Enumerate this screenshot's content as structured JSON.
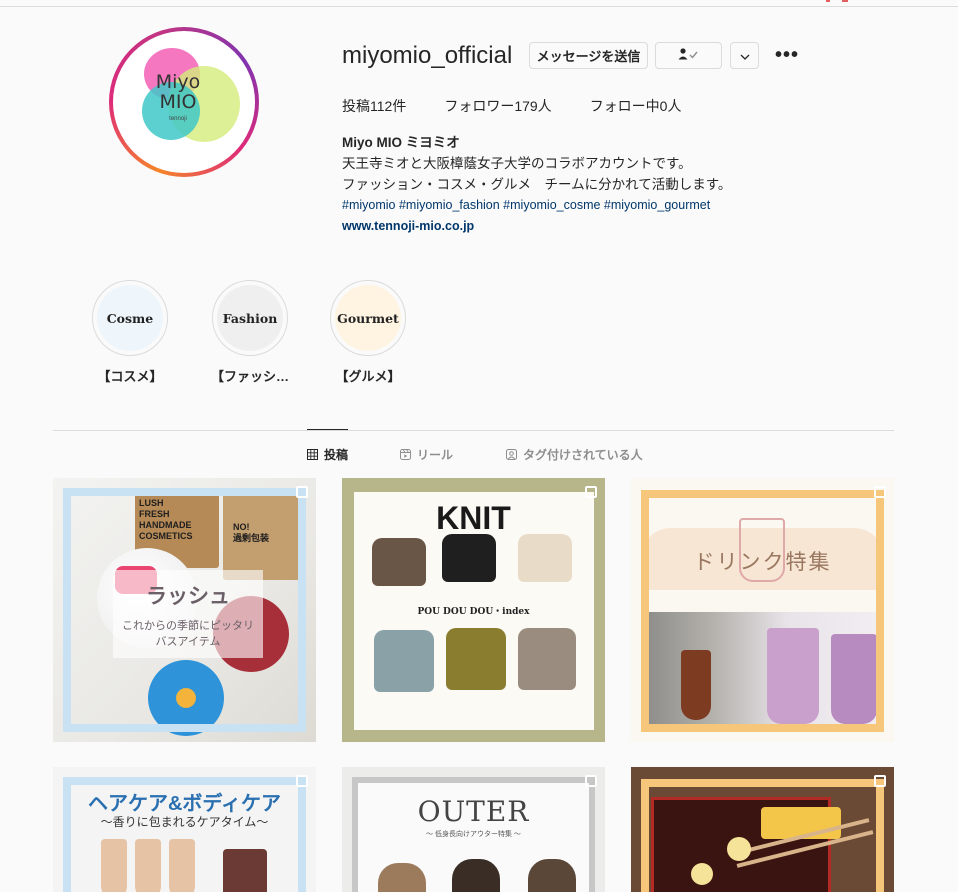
{
  "profile": {
    "username": "miyomio_official",
    "avatar_line1": "Miyo",
    "avatar_line2": "MIO",
    "avatar_sub": "tennoji",
    "message_button": "メッセージを送信",
    "follow_icon": "person-check-icon",
    "more_icon": "chevron-down-icon",
    "options_icon": "ellipsis-icon",
    "options_label": "•••"
  },
  "stats": {
    "posts": "投稿112件",
    "followers": "フォロワー179人",
    "following": "フォロー中0人"
  },
  "bio": {
    "name": "Miyo MIO ミヨミオ",
    "line1": "天王寺ミオと大阪樟蔭女子大学のコラボアカウントです。",
    "line2": "ファッション・コスメ・グルメ　チームに分かれて活動します。",
    "tags": "#miyomio #miyomio_fashion #miyomio_cosme #miyomio_gourmet",
    "link": "www.tennoji-mio.co.jp"
  },
  "highlights": [
    {
      "cover_text": "Cosme",
      "label": "【コスメ】"
    },
    {
      "cover_text": "Fashion",
      "label": "【ファッシ…"
    },
    {
      "cover_text": "Gourmet",
      "label": "【グルメ】"
    }
  ],
  "tabs": [
    {
      "label": "投稿",
      "icon": "grid-icon"
    },
    {
      "label": "リール",
      "icon": "reels-icon"
    },
    {
      "label": "タグ付けされている人",
      "icon": "tagged-icon"
    }
  ],
  "posts": [
    {
      "lush_text": "LUSH\nFRESH\nHANDMADE\nCOSMETICS",
      "bag_text": "NO!\n過剰包装",
      "title": "ラッシュ",
      "subtitle_1": "これからの季節にピッタリ",
      "subtitle_2": "バスアイテム"
    },
    {
      "title": "KNIT",
      "subtitle": "POU DOU DOU・index"
    },
    {
      "title": "ドリンク特集"
    },
    {
      "title": "ヘアケア&ボディケア",
      "subtitle": "〜香りに包まれるケアタイム〜"
    },
    {
      "title": "OUTER",
      "subtitle": "〜 低身長向けアウター特集 〜"
    },
    {}
  ],
  "colors": {
    "avatar_ring": [
      "#f58529",
      "#dd2a7b",
      "#8134af"
    ],
    "link": "#00376b",
    "border": "#dbdbdb",
    "frame_blue": "#c9e2f3",
    "frame_orange": "#f6c77a"
  }
}
